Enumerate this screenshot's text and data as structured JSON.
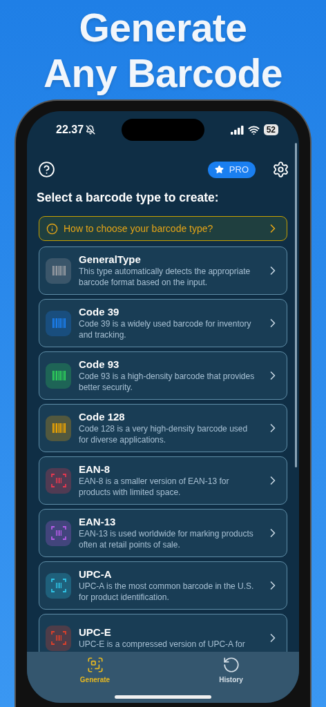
{
  "headline": [
    "Generate",
    "Any Barcode"
  ],
  "status_bar": {
    "time": "22.37",
    "battery": "52"
  },
  "header": {
    "pro_badge": "PRO",
    "title": "Select a barcode type to create:"
  },
  "info_banner": {
    "text": "How to choose your barcode type?"
  },
  "barcode_types": [
    {
      "name": "GeneralType",
      "description": "This type automatically detects the appropriate barcode format based on the input.",
      "kind": "bars",
      "color": "#9a9ea4"
    },
    {
      "name": "Code 39",
      "description": "Code 39 is a widely used barcode for inventory and tracking.",
      "kind": "bars",
      "color": "#1a7ff0"
    },
    {
      "name": "Code 93",
      "description": "Code 93 is a high-density barcode that provides better security.",
      "kind": "bars",
      "color": "#2ed15a"
    },
    {
      "name": "Code 128",
      "description": "Code 128 is a very high-density barcode used for diverse applications.",
      "kind": "bars",
      "color": "#f0a500"
    },
    {
      "name": "EAN-8",
      "description": "EAN-8 is a smaller version of EAN-13 for products with limited space.",
      "kind": "framed",
      "color": "#e8384f"
    },
    {
      "name": "EAN-13",
      "description": "EAN-13 is used worldwide for marking products often at retail points of sale.",
      "kind": "framed",
      "color": "#b55ce8"
    },
    {
      "name": "UPC-A",
      "description": "UPC-A is the most common barcode in the U.S. for product identification.",
      "kind": "framed",
      "color": "#2fc4e6"
    },
    {
      "name": "UPC-E",
      "description": "UPC-E is a compressed version of UPC-A for",
      "kind": "framed",
      "color": "#e0402a"
    }
  ],
  "tab_bar": [
    {
      "label": "Generate",
      "selected": true
    },
    {
      "label": "History",
      "selected": false
    }
  ]
}
